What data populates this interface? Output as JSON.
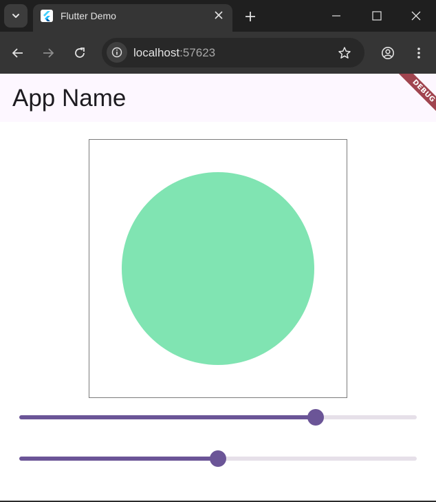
{
  "browser": {
    "tab": {
      "title": "Flutter Demo",
      "favicon": "flutter-logo-icon"
    },
    "url": {
      "host": "localhost",
      "port": ":57623"
    }
  },
  "app": {
    "title": "App Name",
    "debug_banner": "DEBUG"
  },
  "canvas": {
    "shape": "circle",
    "color": "#80e4b2"
  },
  "sliders": [
    {
      "value": 0.745,
      "active_color": "#6b5597",
      "inactive_color": "#e6e0e9"
    },
    {
      "value": 0.5,
      "active_color": "#6b5597",
      "inactive_color": "#e6e0e9"
    }
  ]
}
